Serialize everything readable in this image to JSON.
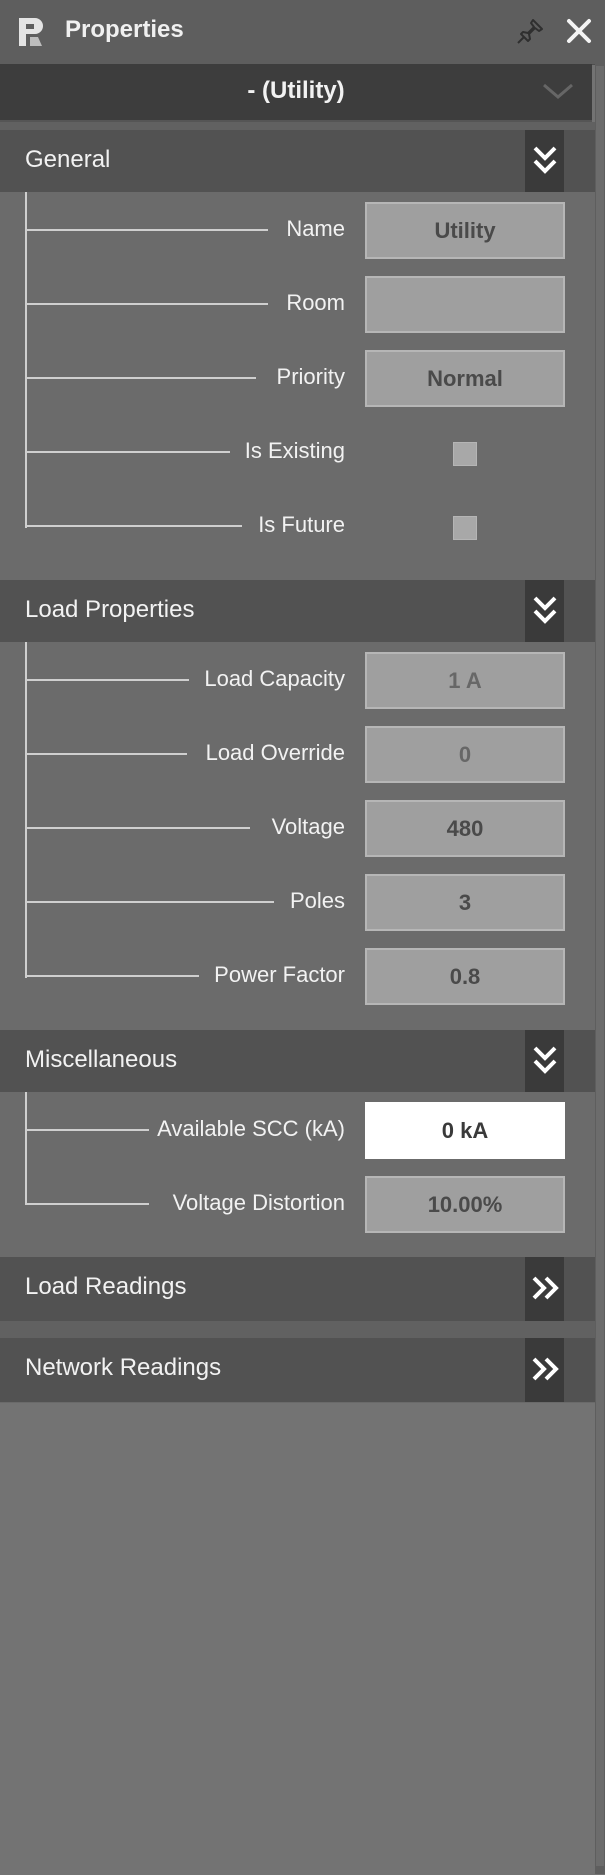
{
  "window": {
    "title": "Properties"
  },
  "selector": {
    "value": "- (Utility)"
  },
  "sections": {
    "general": {
      "title": "General",
      "rows": {
        "name": {
          "label": "Name",
          "value": "Utility"
        },
        "room": {
          "label": "Room",
          "value": ""
        },
        "priority": {
          "label": "Priority",
          "value": "Normal"
        },
        "is_existing": {
          "label": "Is Existing",
          "checked": false
        },
        "is_future": {
          "label": "Is Future",
          "checked": false
        }
      }
    },
    "load_properties": {
      "title": "Load Properties",
      "rows": {
        "load_capacity": {
          "label": "Load Capacity",
          "value": "1 A"
        },
        "load_override": {
          "label": "Load Override",
          "value": "0"
        },
        "voltage": {
          "label": "Voltage",
          "value": "480"
        },
        "poles": {
          "label": "Poles",
          "value": "3"
        },
        "power_factor": {
          "label": "Power Factor",
          "value": "0.8"
        }
      }
    },
    "miscellaneous": {
      "title": "Miscellaneous",
      "rows": {
        "available_scc": {
          "label": "Available SCC (kA)",
          "value": "0 kA"
        },
        "voltage_distortion": {
          "label": "Voltage Distortion",
          "value": "10.00%"
        }
      }
    },
    "load_readings": {
      "title": "Load Readings",
      "expanded": false
    },
    "network_readings": {
      "title": "Network Readings",
      "expanded": false
    }
  },
  "icons": {
    "logo": "app-logo-icon",
    "pin": "pin-icon",
    "close": "close-icon",
    "dropdown": "chevron-down-icon",
    "collapse": "double-chevron-down-icon",
    "expand": "double-chevron-right-icon"
  },
  "colors": {
    "panel_background": "#737373",
    "header_background": "#525252",
    "section_background": "#6b6b6b",
    "field_background": "#9f9f9f",
    "active_field_background": "#ffffff",
    "text": "#f2f2f2"
  }
}
